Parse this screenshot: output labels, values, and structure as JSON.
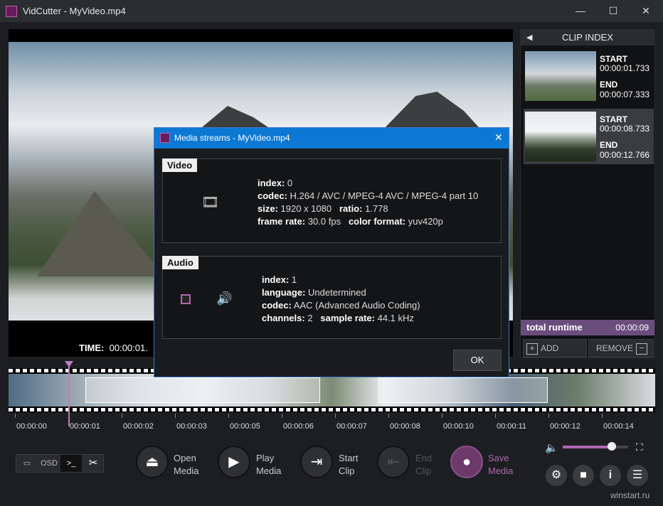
{
  "window": {
    "title": "VidCutter - MyVideo.mp4",
    "minimize": "—",
    "maximize": "☐",
    "close": "✕"
  },
  "player": {
    "time_label": "TIME:",
    "time_value": "00:00:01."
  },
  "clip_index": {
    "title": "CLIP INDEX",
    "collapse_glyph": "◀",
    "clips": [
      {
        "start_label": "START",
        "start": "00:00:01.733",
        "end_label": "END",
        "end": "00:00:07.333"
      },
      {
        "start_label": "START",
        "start": "00:00:08.733",
        "end_label": "END",
        "end": "00:00:12.766"
      }
    ],
    "runtime_label": "total runtime",
    "runtime_value": "00:00:09",
    "add_label": "ADD",
    "remove_label": "REMOVE"
  },
  "timeline": {
    "ticks": [
      "00:00:00",
      "00:00:01",
      "00:00:02",
      "00:00:03",
      "00:00:05",
      "00:00:06",
      "00:00:07",
      "00:00:08",
      "00:00:10",
      "00:00:11",
      "00:00:12",
      "00:00:14"
    ]
  },
  "toolbar": {
    "osd": "OSD",
    "console": ">_",
    "cut": "✂",
    "open_line1": "Open",
    "open_line2": "Media",
    "play_line1": "Play",
    "play_line2": "Media",
    "start_line1": "Start",
    "start_line2": "Clip",
    "end_line1": "End",
    "end_line2": "Clip",
    "save_line1": "Save",
    "save_line2": "Media"
  },
  "volume": {
    "level": 0.75
  },
  "watermark": "winstart.ru",
  "dialog": {
    "title": "Media streams - MyVideo.mp4",
    "close": "✕",
    "video_tag": "Video",
    "video": {
      "index_k": "index:",
      "index_v": "0",
      "codec_k": "codec:",
      "codec_v": "H.264 / AVC / MPEG-4 AVC / MPEG-4 part 10",
      "size_k": "size:",
      "size_v": "1920 x 1080",
      "ratio_k": "ratio:",
      "ratio_v": "1.778",
      "fps_k": "frame rate:",
      "fps_v": "30.0 fps",
      "color_k": "color format:",
      "color_v": "yuv420p"
    },
    "audio_tag": "Audio",
    "audio": {
      "index_k": "index:",
      "index_v": "1",
      "lang_k": "language:",
      "lang_v": "Undetermined",
      "codec_k": "codec:",
      "codec_v": "AAC (Advanced Audio Coding)",
      "chan_k": "channels:",
      "chan_v": "2",
      "rate_k": "sample rate:",
      "rate_v": "44.1 kHz"
    },
    "ok": "OK"
  },
  "colors": {
    "accent": "#b065b0",
    "dialog_bar": "#0d78d4",
    "runtime_bg": "#6b4d7d"
  }
}
